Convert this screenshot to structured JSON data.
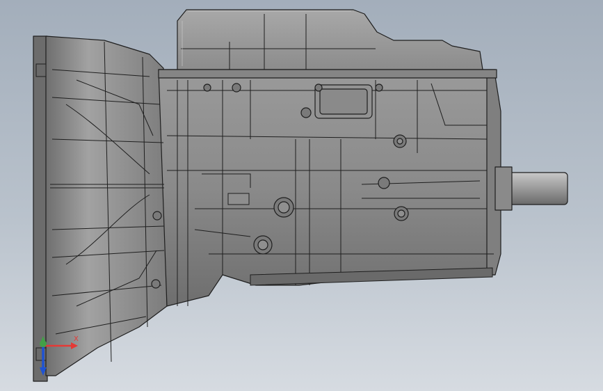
{
  "viewport": {
    "background_top": "#a3aebb",
    "background_bottom": "#d6dbe1",
    "model_color": "#8c8c8c",
    "edge_color": "#1e1e1e"
  },
  "triad": {
    "x_label": "X",
    "x_color": "#e53935",
    "y_color": "#43a047",
    "z_color": "#1e53d4"
  }
}
